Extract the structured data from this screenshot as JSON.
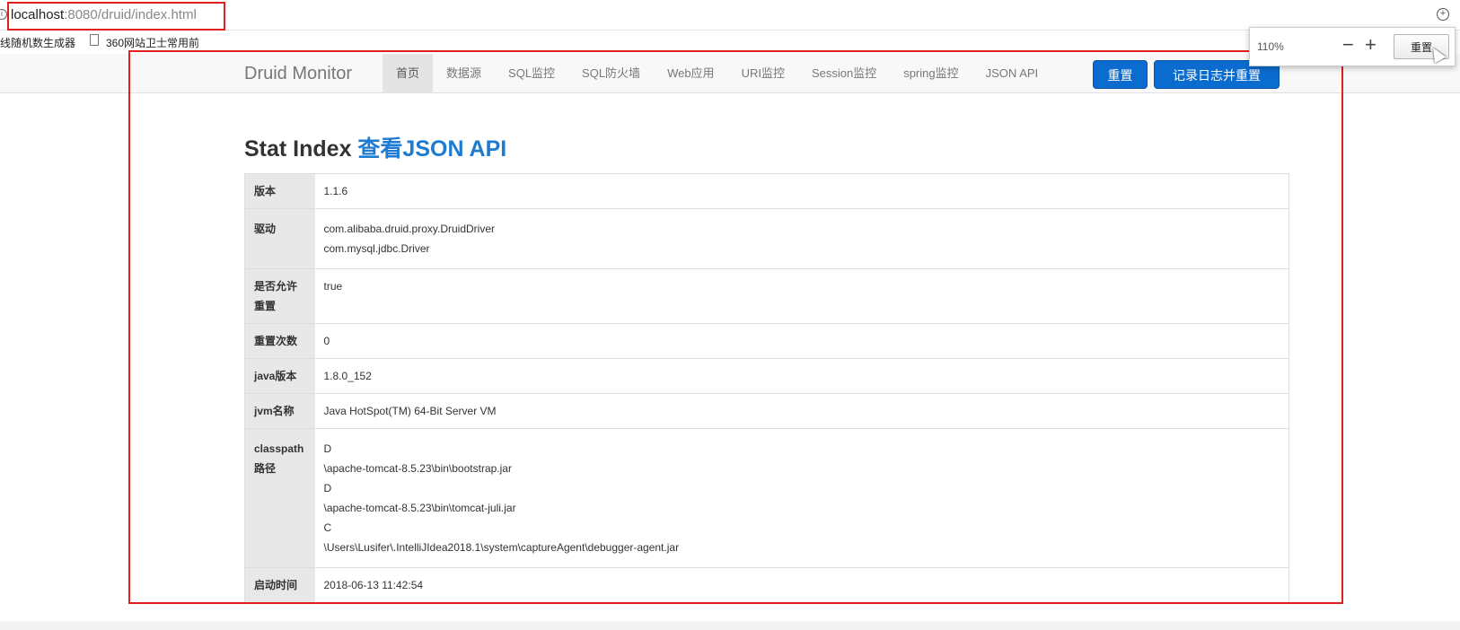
{
  "browser": {
    "url_host": "localhost",
    "url_rest": ":8080/druid/index.html",
    "bookmarks": [
      "线随机数生成器",
      "360网站卫士常用前"
    ]
  },
  "zoom_popup": {
    "level": "110%",
    "minus": "−",
    "plus": "+",
    "reset_label": "重置"
  },
  "navbar": {
    "brand": "Druid Monitor",
    "items": [
      {
        "label": "首页",
        "active": true
      },
      {
        "label": "数据源"
      },
      {
        "label": "SQL监控"
      },
      {
        "label": "SQL防火墙"
      },
      {
        "label": "Web应用"
      },
      {
        "label": "URI监控"
      },
      {
        "label": "Session监控"
      },
      {
        "label": "spring监控"
      },
      {
        "label": "JSON API"
      }
    ],
    "reset_button": "重置",
    "log_reset_button": "记录日志并重置"
  },
  "page": {
    "title_prefix": "Stat Index ",
    "title_link": "查看JSON API"
  },
  "stats": [
    {
      "key": "版本",
      "lines": [
        "1.1.6"
      ]
    },
    {
      "key": "驱动",
      "lines": [
        "com.alibaba.druid.proxy.DruidDriver",
        "com.mysql.jdbc.Driver"
      ]
    },
    {
      "key": "是否允许重置",
      "lines": [
        "true"
      ]
    },
    {
      "key": "重置次数",
      "lines": [
        "0"
      ]
    },
    {
      "key": "java版本",
      "lines": [
        "1.8.0_152"
      ]
    },
    {
      "key": "jvm名称",
      "lines": [
        "Java HotSpot(TM) 64-Bit Server VM"
      ]
    },
    {
      "key": "classpath路径",
      "lines": [
        "D",
        "\\apache-tomcat-8.5.23\\bin\\bootstrap.jar",
        "D",
        "\\apache-tomcat-8.5.23\\bin\\tomcat-juli.jar",
        "C",
        "\\Users\\Lusifer\\.IntelliJIdea2018.1\\system\\captureAgent\\debugger-agent.jar"
      ]
    },
    {
      "key": "启动时间",
      "lines": [
        "2018-06-13 11:42:54"
      ]
    }
  ],
  "colors": {
    "primary": "#0a6ccf",
    "link": "#1d7bd1",
    "annotation": "#e02020"
  }
}
